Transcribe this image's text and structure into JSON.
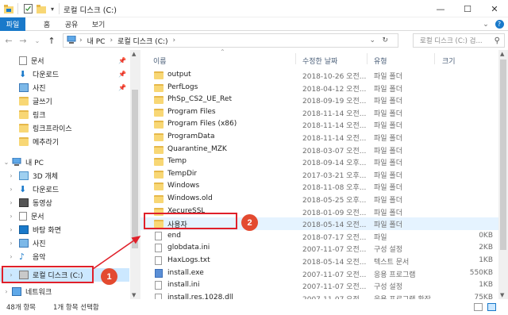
{
  "window": {
    "title": "로컬 디스크 (C:)",
    "minimize_icon": "—",
    "maximize_icon": "☐",
    "close_icon": "✕"
  },
  "ribbon": {
    "tabs": [
      "파일",
      "홈",
      "공유",
      "보기"
    ],
    "expand_icon": "⌄",
    "help_icon": "?"
  },
  "address": {
    "back": "←",
    "forward": "→",
    "recent": "⌄",
    "up": "↑",
    "path": [
      "내 PC",
      "로컬 디스크 (C:)"
    ],
    "sep": "›",
    "dropdown": "⌄",
    "refresh": "↻",
    "search_placeholder": "로컬 디스크 (C:) 검...",
    "search_icon": "⚲"
  },
  "nav": {
    "quick": [
      {
        "label": "문서",
        "pinned": true
      },
      {
        "label": "다운로드",
        "pinned": true
      },
      {
        "label": "사진",
        "pinned": true
      },
      {
        "label": "글쓰기",
        "pinned": false
      },
      {
        "label": "링크",
        "pinned": false
      },
      {
        "label": "링크프라이스",
        "pinned": false
      },
      {
        "label": "메추라기",
        "pinned": false
      }
    ],
    "pc_label": "내 PC",
    "pc_items": [
      "3D 개체",
      "다운로드",
      "동영상",
      "문서",
      "바탕 화면",
      "사진",
      "음악",
      "로컬 디스크 (C:)"
    ],
    "network": "네트워크"
  },
  "columns": {
    "name": "이름",
    "date": "수정한 날짜",
    "type": "유형",
    "size": "크기"
  },
  "files": [
    {
      "name": "output",
      "date": "2018-10-26 오전...",
      "type": "파일 폴더",
      "size": "",
      "kind": "folder"
    },
    {
      "name": "PerfLogs",
      "date": "2018-04-12 오전...",
      "type": "파일 폴더",
      "size": "",
      "kind": "folder"
    },
    {
      "name": "PhSp_CS2_UE_Ret",
      "date": "2018-09-19 오전...",
      "type": "파일 폴더",
      "size": "",
      "kind": "folder"
    },
    {
      "name": "Program Files",
      "date": "2018-11-14 오전...",
      "type": "파일 폴더",
      "size": "",
      "kind": "folder"
    },
    {
      "name": "Program Files (x86)",
      "date": "2018-11-14 오전...",
      "type": "파일 폴더",
      "size": "",
      "kind": "folder"
    },
    {
      "name": "ProgramData",
      "date": "2018-11-14 오전...",
      "type": "파일 폴더",
      "size": "",
      "kind": "folder"
    },
    {
      "name": "Quarantine_MZK",
      "date": "2018-03-07 오전...",
      "type": "파일 폴더",
      "size": "",
      "kind": "folder"
    },
    {
      "name": "Temp",
      "date": "2018-09-14 오후...",
      "type": "파일 폴더",
      "size": "",
      "kind": "folder"
    },
    {
      "name": "TempDir",
      "date": "2017-03-21 오후...",
      "type": "파일 폴더",
      "size": "",
      "kind": "folder"
    },
    {
      "name": "Windows",
      "date": "2018-11-08 오후...",
      "type": "파일 폴더",
      "size": "",
      "kind": "folder"
    },
    {
      "name": "Windows.old",
      "date": "2018-05-25 오후...",
      "type": "파일 폴더",
      "size": "",
      "kind": "folder"
    },
    {
      "name": "XecureSSL",
      "date": "2018-01-09 오전...",
      "type": "파일 폴더",
      "size": "",
      "kind": "folder"
    },
    {
      "name": "사용자",
      "date": "2018-05-14 오전...",
      "type": "파일 폴더",
      "size": "",
      "kind": "folder"
    },
    {
      "name": "end",
      "date": "2018-07-17 오전...",
      "type": "파일",
      "size": "0KB",
      "kind": "doc"
    },
    {
      "name": "globdata.ini",
      "date": "2007-11-07 오전...",
      "type": "구성 설정",
      "size": "2KB",
      "kind": "doc"
    },
    {
      "name": "HaxLogs.txt",
      "date": "2018-05-14 오전...",
      "type": "텍스트 문서",
      "size": "1KB",
      "kind": "doc"
    },
    {
      "name": "install.exe",
      "date": "2007-11-07 오전...",
      "type": "응용 프로그램",
      "size": "550KB",
      "kind": "exe"
    },
    {
      "name": "install.ini",
      "date": "2007-11-07 오전...",
      "type": "구성 설정",
      "size": "1KB",
      "kind": "doc"
    },
    {
      "name": "install.res.1028.dll",
      "date": "2007-11-07 오전...",
      "type": "응용 프로그램 확장",
      "size": "75KB",
      "kind": "doc"
    }
  ],
  "status": {
    "count": "48개 항목",
    "selected": "1개 항목 선택함"
  },
  "annotations": [
    "1",
    "2"
  ]
}
